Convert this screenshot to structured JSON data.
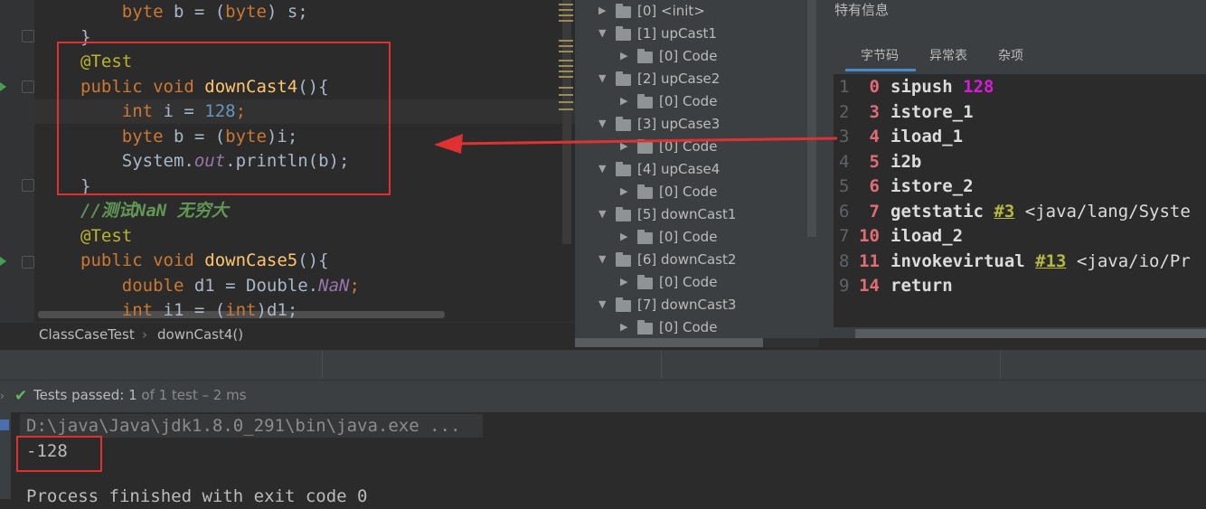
{
  "editor": {
    "lines": [
      {
        "indent": "    ",
        "segments": [
          {
            "t": "byte ",
            "c": "kw"
          },
          {
            "t": "b = (",
            "c": ""
          },
          {
            "t": "byte",
            "c": "kw"
          },
          {
            "t": ") s;",
            "c": ""
          }
        ]
      },
      {
        "indent": "",
        "segments": [
          {
            "t": "}",
            "c": ""
          }
        ]
      },
      {
        "indent": "",
        "segments": [
          {
            "t": "@Test",
            "c": "ann"
          }
        ]
      },
      {
        "indent": "",
        "segments": [
          {
            "t": "public void ",
            "c": "kw"
          },
          {
            "t": "downCast4",
            "c": "fn"
          },
          {
            "t": "(){",
            "c": ""
          }
        ]
      },
      {
        "indent": "    ",
        "segments": [
          {
            "t": "int ",
            "c": "kw"
          },
          {
            "t": "i = ",
            "c": ""
          },
          {
            "t": "128",
            "c": "num"
          },
          {
            "t": ";",
            "c": "kw"
          }
        ]
      },
      {
        "indent": "    ",
        "segments": [
          {
            "t": "byte ",
            "c": "kw"
          },
          {
            "t": "b = (",
            "c": ""
          },
          {
            "t": "byte",
            "c": "kw"
          },
          {
            "t": ")i;",
            "c": ""
          }
        ]
      },
      {
        "indent": "    ",
        "segments": [
          {
            "t": "System.",
            "c": ""
          },
          {
            "t": "out",
            "c": "fld"
          },
          {
            "t": ".println(b);",
            "c": ""
          }
        ]
      },
      {
        "indent": "",
        "segments": [
          {
            "t": "}",
            "c": ""
          }
        ]
      },
      {
        "indent": "",
        "segments": [
          {
            "t": "//测试NaN 无穷大",
            "c": "cmt"
          }
        ]
      },
      {
        "indent": "",
        "segments": [
          {
            "t": "@Test",
            "c": "ann"
          }
        ]
      },
      {
        "indent": "",
        "segments": [
          {
            "t": "public void ",
            "c": "kw"
          },
          {
            "t": "downCase5",
            "c": "fn"
          },
          {
            "t": "(){",
            "c": ""
          }
        ]
      },
      {
        "indent": "    ",
        "segments": [
          {
            "t": "double ",
            "c": "kw"
          },
          {
            "t": "d1 = Double.",
            "c": ""
          },
          {
            "t": "NaN",
            "c": "fld"
          },
          {
            "t": ";",
            "c": "kw"
          }
        ]
      },
      {
        "indent": "    ",
        "segments": [
          {
            "t": "int ",
            "c": "kw"
          },
          {
            "t": "i1 = (",
            "c": ""
          },
          {
            "t": "int",
            "c": "kw"
          },
          {
            "t": ")d1;",
            "c": ""
          }
        ]
      }
    ]
  },
  "tree": {
    "items": [
      {
        "label": "[0] <init>",
        "level": 0,
        "expanded": false
      },
      {
        "label": "[1] upCast1",
        "level": 0,
        "expanded": true
      },
      {
        "label": "[0] Code",
        "level": 1,
        "expanded": false
      },
      {
        "label": "[2] upCase2",
        "level": 0,
        "expanded": true
      },
      {
        "label": "[0] Code",
        "level": 1,
        "expanded": false
      },
      {
        "label": "[3] upCase3",
        "level": 0,
        "expanded": true
      },
      {
        "label": "[0] Code",
        "level": 1,
        "expanded": false
      },
      {
        "label": "[4] upCase4",
        "level": 0,
        "expanded": true
      },
      {
        "label": "[0] Code",
        "level": 1,
        "expanded": false
      },
      {
        "label": "[5] downCast1",
        "level": 0,
        "expanded": true
      },
      {
        "label": "[0] Code",
        "level": 1,
        "expanded": false
      },
      {
        "label": "[6] downCast2",
        "level": 0,
        "expanded": true
      },
      {
        "label": "[0] Code",
        "level": 1,
        "expanded": false
      },
      {
        "label": "[7] downCast3",
        "level": 0,
        "expanded": true
      },
      {
        "label": "[0] Code",
        "level": 1,
        "expanded": false
      }
    ]
  },
  "panel": {
    "title": "特有信息",
    "tabs": [
      "字节码",
      "异常表",
      "杂项"
    ],
    "active_tab": "字节码",
    "bytecode": [
      {
        "line": "1",
        "offset": "0",
        "op": "sipush",
        "arg": "128",
        "arg_type": "magenta",
        "rest": ""
      },
      {
        "line": "2",
        "offset": "3",
        "op": "istore_1",
        "arg": "",
        "arg_type": "",
        "rest": ""
      },
      {
        "line": "3",
        "offset": "4",
        "op": "iload_1",
        "arg": "",
        "arg_type": "",
        "rest": ""
      },
      {
        "line": "4",
        "offset": "5",
        "op": "i2b",
        "arg": "",
        "arg_type": "",
        "rest": ""
      },
      {
        "line": "5",
        "offset": "6",
        "op": "istore_2",
        "arg": "",
        "arg_type": "",
        "rest": ""
      },
      {
        "line": "6",
        "offset": "7",
        "op": "getstatic",
        "arg": "#3",
        "arg_type": "ref",
        "rest": "<java/lang/Syste"
      },
      {
        "line": "7",
        "offset": "10",
        "op": "iload_2",
        "arg": "",
        "arg_type": "",
        "rest": ""
      },
      {
        "line": "8",
        "offset": "11",
        "op": "invokevirtual",
        "arg": "#13",
        "arg_type": "ref",
        "rest": "<java/io/Pr"
      },
      {
        "line": "9",
        "offset": "14",
        "op": "return",
        "arg": "",
        "arg_type": "",
        "rest": ""
      }
    ]
  },
  "breadcrumb": {
    "class": "ClassCaseTest",
    "separator": "›",
    "method": "downCast4()"
  },
  "status": {
    "label": "Tests passed:",
    "count": "1",
    "detail": "of 1 test – 2 ms"
  },
  "console": {
    "command": "D:\\java\\Java\\jdk1.8.0_291\\bin\\java.exe ...",
    "output": "-128",
    "exit": "Process finished with exit code 0"
  },
  "colors": {
    "annotation_red": "#e03131",
    "accent": "#4a88c7"
  }
}
